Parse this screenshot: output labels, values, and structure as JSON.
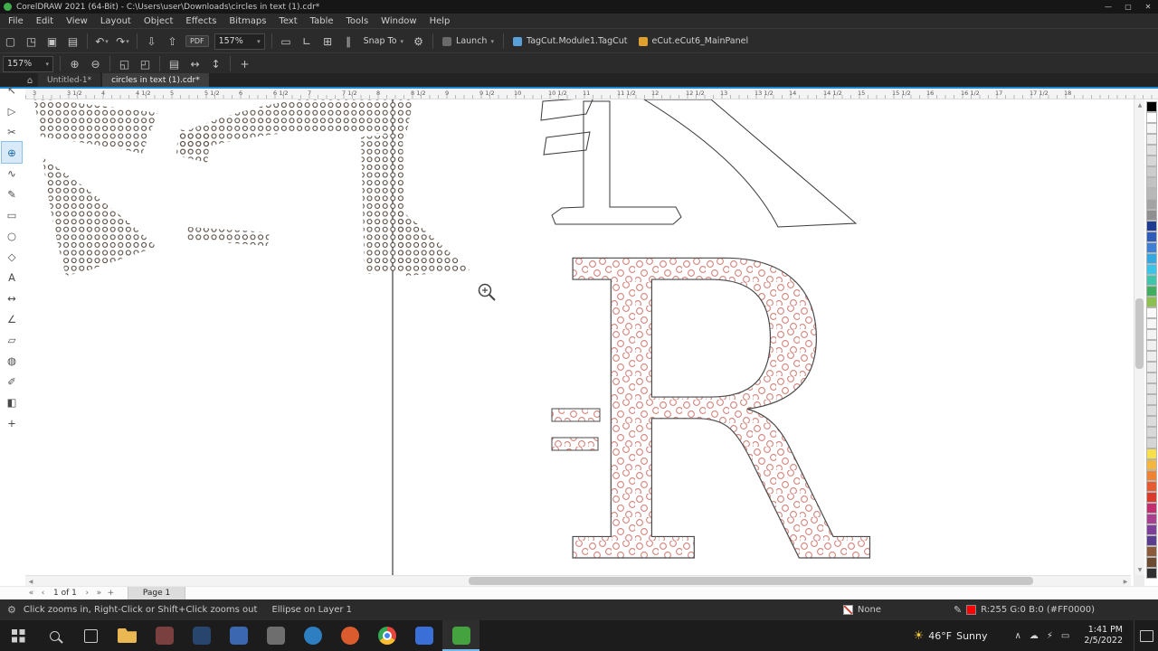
{
  "window": {
    "title": "CorelDRAW 2021 (64-Bit) - C:\\Users\\user\\Downloads\\circles in text (1).cdr*",
    "controls": [
      {
        "name": "minimize-button",
        "glyph": "—"
      },
      {
        "name": "maximize-button",
        "glyph": "▢"
      },
      {
        "name": "close-button",
        "glyph": "✕"
      }
    ]
  },
  "menubar": {
    "items": [
      "File",
      "Edit",
      "View",
      "Layout",
      "Object",
      "Effects",
      "Bitmaps",
      "Text",
      "Table",
      "Tools",
      "Window",
      "Help"
    ]
  },
  "toolbar_main": {
    "items": [
      {
        "type": "icon",
        "name": "new-document-button",
        "glyph": "▢"
      },
      {
        "type": "icon",
        "name": "open-button",
        "glyph": "◳"
      },
      {
        "type": "icon",
        "name": "save-button",
        "glyph": "▣"
      },
      {
        "type": "icon",
        "name": "print-button",
        "glyph": "▤"
      },
      {
        "type": "sep"
      },
      {
        "type": "icon-drop",
        "name": "undo-button",
        "glyph": "↶"
      },
      {
        "type": "icon-drop",
        "name": "redo-button",
        "glyph": "↷"
      },
      {
        "type": "sep"
      },
      {
        "type": "icon",
        "name": "import-button",
        "glyph": "⇩"
      },
      {
        "type": "icon",
        "name": "export-button",
        "glyph": "⇧"
      },
      {
        "type": "badge",
        "name": "publish-to-pdf-button",
        "label": "PDF"
      },
      {
        "type": "combo",
        "name": "zoom-level-combo",
        "label": "157%"
      },
      {
        "type": "sep"
      },
      {
        "type": "icon",
        "name": "full-screen-preview-button",
        "glyph": "▭"
      },
      {
        "type": "icon",
        "name": "show-rulers-button",
        "glyph": "∟"
      },
      {
        "type": "icon",
        "name": "show-grid-button",
        "glyph": "⊞"
      },
      {
        "type": "icon",
        "name": "show-guidelines-button",
        "glyph": "∥"
      },
      {
        "type": "label-drop",
        "name": "snap-to-dropdown",
        "label": "Snap To"
      },
      {
        "type": "icon",
        "name": "options-button",
        "glyph": "⚙"
      },
      {
        "type": "sep"
      },
      {
        "type": "plugin",
        "name": "launch-button",
        "label": "Launch",
        "color": "#6a6a6a",
        "caret": true
      },
      {
        "type": "sep"
      },
      {
        "type": "plugin",
        "name": "tagcut-macro-button",
        "label": "TagCut.Module1.TagCut",
        "color": "#5aa0d8",
        "caret": false
      },
      {
        "type": "plugin",
        "name": "ecut-panel-button",
        "label": "eCut.eCut6_MainPanel",
        "color": "#e0a030",
        "caret": false
      }
    ]
  },
  "toolbar_zoom": {
    "items": [
      {
        "type": "combo",
        "name": "zoom-levels-combo",
        "label": "157%"
      },
      {
        "type": "sep"
      },
      {
        "type": "icon",
        "name": "zoom-in-button",
        "glyph": "⊕"
      },
      {
        "type": "icon",
        "name": "zoom-out-button",
        "glyph": "⊖"
      },
      {
        "type": "sep"
      },
      {
        "type": "icon",
        "name": "zoom-to-selection-button",
        "glyph": "◱"
      },
      {
        "type": "icon",
        "name": "zoom-to-all-objects-button",
        "glyph": "◰"
      },
      {
        "type": "sep"
      },
      {
        "type": "icon",
        "name": "zoom-to-page-button",
        "glyph": "▤"
      },
      {
        "type": "icon",
        "name": "zoom-to-page-width-button",
        "glyph": "↔"
      },
      {
        "type": "icon",
        "name": "zoom-to-page-height-button",
        "glyph": "↕"
      },
      {
        "type": "sep"
      },
      {
        "type": "icon",
        "name": "customize-toolbar-button",
        "glyph": "+"
      }
    ]
  },
  "doctabs": {
    "home_glyph": "⌂",
    "tabs": [
      {
        "label": "Untitled-1*",
        "active": false
      },
      {
        "label": "circles in text (1).cdr*",
        "active": true
      }
    ]
  },
  "ruler": {
    "labels": [
      "3",
      "3 1/2",
      "4",
      "4 1/2",
      "5",
      "5 1/2",
      "6",
      "6 1/2",
      "7",
      "7 1/2",
      "8",
      "8 1/2",
      "9",
      "9 1/2",
      "10",
      "10 1/2",
      "11",
      "11 1/2",
      "12",
      "12 1/2",
      "13",
      "13 1/2",
      "14",
      "14 1/2",
      "15",
      "15 1/2",
      "16",
      "16 1/2",
      "17",
      "17 1/2",
      "18"
    ]
  },
  "toolbox": {
    "tools": [
      {
        "name": "pick-tool",
        "glyph": "↖",
        "active": false
      },
      {
        "name": "shape-tool",
        "glyph": "▷",
        "active": false
      },
      {
        "name": "crop-tool",
        "glyph": "✂",
        "active": false
      },
      {
        "name": "zoom-tool",
        "glyph": "⊕",
        "active": true
      },
      {
        "name": "freehand-tool",
        "glyph": "∿",
        "active": false
      },
      {
        "name": "artistic-media-tool",
        "glyph": "✎",
        "active": false
      },
      {
        "name": "rectangle-tool",
        "glyph": "▭",
        "active": false
      },
      {
        "name": "ellipse-tool",
        "glyph": "○",
        "active": false
      },
      {
        "name": "polygon-tool",
        "glyph": "◇",
        "active": false
      },
      {
        "name": "text-tool",
        "glyph": "A",
        "active": false
      },
      {
        "name": "dimension-tool",
        "glyph": "↔",
        "active": false
      },
      {
        "name": "connector-tool",
        "glyph": "∠",
        "active": false
      },
      {
        "name": "drop-shadow-tool",
        "glyph": "▱",
        "active": false
      },
      {
        "name": "transparency-tool",
        "glyph": "◍",
        "active": false
      },
      {
        "name": "color-eyedropper-tool",
        "glyph": "✐",
        "active": false
      },
      {
        "name": "interactive-fill-tool",
        "glyph": "◧",
        "active": false
      },
      {
        "name": "more-tools-button",
        "glyph": "+",
        "active": false
      }
    ]
  },
  "palette": {
    "colors": [
      "#000000",
      "#ffffff",
      "#f5f5f5",
      "#ebebeb",
      "#e0e0e0",
      "#d6d6d6",
      "#cccccc",
      "#c2c2c2",
      "#b8b8b8",
      "#a3a3a3",
      "#8f8f8f",
      "#1f3a93",
      "#2e5cb8",
      "#3f7fd4",
      "#35a8e0",
      "#3bc3e8",
      "#40c4aa",
      "#3faf5f",
      "#8cc152",
      "#f9f9f9",
      "#f6f6f6",
      "#f3f3f3",
      "#f0f0f0",
      "#ededed",
      "#eaeaea",
      "#e7e7e7",
      "#e4e4e4",
      "#e1e1e1",
      "#dedede",
      "#dbdbdb",
      "#d8d8d8",
      "#d5d5d5",
      "#f7e04b",
      "#f5b63f",
      "#ee8334",
      "#e45b32",
      "#d93a2b",
      "#c22f6e",
      "#a8408f",
      "#7d3f98",
      "#5a3d8f",
      "#8a5a3b",
      "#6b4a2f",
      "#303030"
    ]
  },
  "pagebar": {
    "nav_left": [
      {
        "name": "first-page-button",
        "glyph": "«"
      },
      {
        "name": "prev-page-button",
        "glyph": "‹"
      }
    ],
    "label": "1 of 1",
    "nav_right": [
      {
        "name": "next-page-button",
        "glyph": "›"
      },
      {
        "name": "last-page-button",
        "glyph": "»"
      },
      {
        "name": "add-page-button",
        "glyph": "+"
      }
    ],
    "page_tab": "Page 1"
  },
  "statusbar": {
    "hint": "Click zooms in, Right-Click or Shift+Click zooms out",
    "object_info": "Ellipse on Layer 1",
    "fill_label": "None",
    "outline_color_label": "R:255 G:0 B:0 (#FF0000)",
    "outline_color": "#FF0000"
  },
  "taskbar": {
    "apps": [
      {
        "name": "file-explorer",
        "kind": "folder",
        "color": "#e9b852",
        "active": false
      },
      {
        "name": "app-icon-2",
        "kind": "square",
        "color": "#7a4040",
        "active": false
      },
      {
        "name": "app-icon-3",
        "kind": "square",
        "color": "#28456e",
        "active": false
      },
      {
        "name": "app-icon-4",
        "kind": "square",
        "color": "#3b66b0",
        "active": false
      },
      {
        "name": "app-icon-5",
        "kind": "square",
        "color": "#6e6e6e",
        "active": false
      },
      {
        "name": "app-icon-6",
        "kind": "circle",
        "color": "#2d7fc1",
        "active": false
      },
      {
        "name": "app-icon-7",
        "kind": "circle",
        "color": "#d95b2e",
        "active": false
      },
      {
        "name": "chrome",
        "kind": "chrome",
        "color": "",
        "active": false
      },
      {
        "name": "app-icon-9",
        "kind": "square",
        "color": "#3a6fd8",
        "active": false
      },
      {
        "name": "coreldraw",
        "kind": "square",
        "color": "#44a33f",
        "active": true
      }
    ],
    "weather": {
      "icon": "☀",
      "temp": "46°F",
      "condition": "Sunny"
    },
    "tray": [
      {
        "name": "tray-expand",
        "glyph": "∧"
      },
      {
        "name": "tray-cloud",
        "glyph": "☁"
      },
      {
        "name": "tray-power",
        "glyph": "⚡"
      },
      {
        "name": "tray-battery",
        "glyph": "▭"
      }
    ],
    "clock": {
      "time": "1:41 PM",
      "date": "2/5/2022"
    }
  }
}
